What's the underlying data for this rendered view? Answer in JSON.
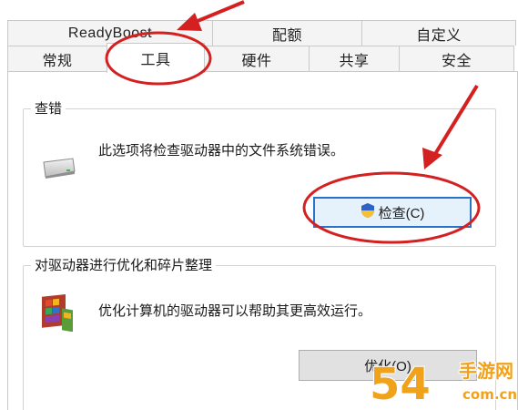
{
  "tabs": {
    "row_top": [
      "ReadyBoost",
      "配额",
      "自定义"
    ],
    "row_bottom": [
      "常规",
      "工具",
      "硬件",
      "共享",
      "安全"
    ],
    "active": "工具"
  },
  "error_check": {
    "title": "查错",
    "description": "此选项将检查驱动器中的文件系统错误。",
    "button_label": "检查(C)"
  },
  "optimize": {
    "title": "对驱动器进行优化和碎片整理",
    "description": "优化计算机的驱动器可以帮助其更高效运行。",
    "button_label": "优化(O)"
  },
  "watermark": {
    "number": "54",
    "brand": "手游网",
    "domain": "com.cn"
  },
  "colors": {
    "annotation_red": "#d42020",
    "focus_blue": "#2a72c8",
    "watermark_orange": "#f0a21a"
  },
  "icons": [
    "drive-icon",
    "defrag-icon",
    "uac-shield-icon"
  ]
}
